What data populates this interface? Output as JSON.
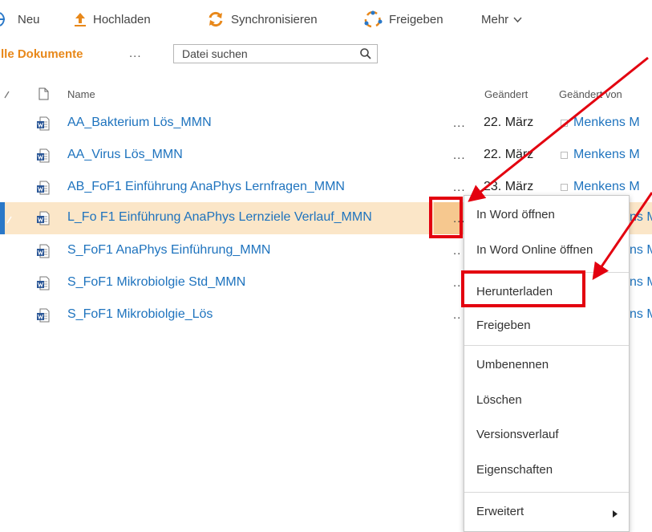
{
  "toolbar": {
    "new_label": "Neu",
    "upload_label": "Hochladen",
    "sync_label": "Synchronisieren",
    "share_label": "Freigeben",
    "more_label": "Mehr"
  },
  "view": {
    "title": "lle Dokumente",
    "menu_dots": "...",
    "search_placeholder": "Datei suchen"
  },
  "columns": {
    "name": "Name",
    "modified": "Geändert",
    "modified_by": "Geändert von"
  },
  "rows": [
    {
      "name": "AA_Bakterium Lös_MMN",
      "dots": "...",
      "date": "22. März",
      "modified_by": "Menkens M"
    },
    {
      "name": "AA_Virus Lös_MMN",
      "dots": "...",
      "date": "22. März",
      "modified_by": "Menkens M"
    },
    {
      "name": "AB_FoF1 Einführung AnaPhys Lernfragen_MMN",
      "dots": "...",
      "date": "23. März",
      "modified_by": "Menkens M"
    },
    {
      "name": "L_Fo F1 Einführung AnaPhys Lernziele Verlauf_MMN",
      "dots": "...",
      "date": "",
      "modified_by": "ns M",
      "selected": true
    },
    {
      "name": "S_FoF1 AnaPhys Einführung_MMN",
      "dots": "..",
      "date": "",
      "modified_by": "ns M"
    },
    {
      "name": "S_FoF1 Mikrobiolgie Std_MMN",
      "dots": "..",
      "date": "",
      "modified_by": "ns M"
    },
    {
      "name": "S_FoF1 Mikrobiolgie_Lös",
      "dots": "..",
      "date": "",
      "modified_by": "ns M"
    }
  ],
  "context_menu": {
    "open_word": "In Word öffnen",
    "open_word_online": "In Word Online öffnen",
    "download": "Herunterladen",
    "share": "Freigeben",
    "rename": "Umbenennen",
    "delete": "Löschen",
    "version_history": "Versionsverlauf",
    "properties": "Eigenschaften",
    "advanced": "Erweitert"
  },
  "colors": {
    "accent_orange": "#e8881a",
    "link_blue": "#1e73be",
    "selection": "#fbe6c8",
    "annotation_red": "#e3000f"
  }
}
